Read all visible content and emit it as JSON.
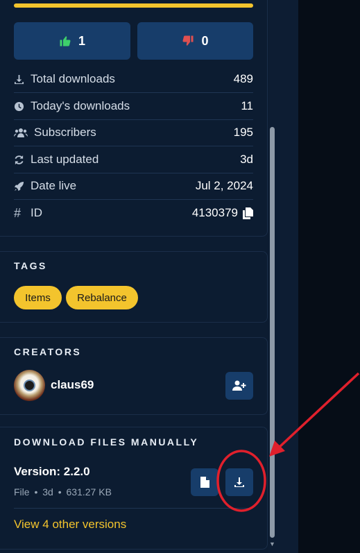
{
  "votes": {
    "up_count": "1",
    "down_count": "0"
  },
  "rating_fill_fraction": 1.0,
  "stats": [
    {
      "icon": "download-icon",
      "label": "Total downloads",
      "value": "489"
    },
    {
      "icon": "clock-icon",
      "label": "Today's downloads",
      "value": "11"
    },
    {
      "icon": "users-icon",
      "label": "Subscribers",
      "value": "195"
    },
    {
      "icon": "refresh-icon",
      "label": "Last updated",
      "value": "3d"
    },
    {
      "icon": "rocket-icon",
      "label": "Date live",
      "value": "Jul 2, 2024"
    },
    {
      "icon": "hash-icon",
      "label": "ID",
      "value": "4130379",
      "hash_glyph": "#"
    }
  ],
  "tags": {
    "title": "TAGS",
    "items": [
      "Items",
      "Rebalance"
    ]
  },
  "creators": {
    "title": "CREATORS",
    "items": [
      {
        "name": "claus69"
      }
    ]
  },
  "download": {
    "title": "DOWNLOAD FILES MANUALLY",
    "version": "Version: 2.2.0",
    "meta": {
      "type": "File",
      "age": "3d",
      "size": "631.27 KB",
      "sep": "•"
    },
    "other_versions": "View 4 other versions"
  },
  "colors": {
    "accent": "#f3c42d",
    "button": "#173d6a",
    "panel": "#0c1c31",
    "annotation": "#e0202c"
  }
}
